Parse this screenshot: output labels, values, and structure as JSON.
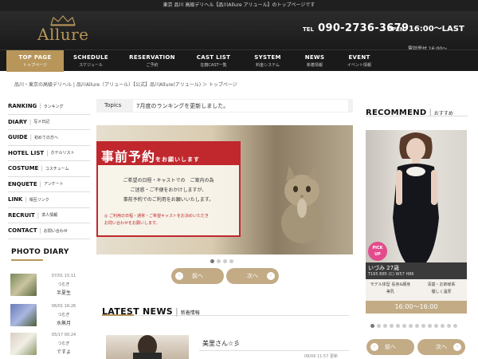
{
  "top_strip": {
    "text": "東京 品川 高級デリヘル【品川Allure アリュール】のトップページです"
  },
  "header": {
    "logo_text": "Allure",
    "tel_label": "TEL",
    "tel_number": "090-2736-3679",
    "open_label": "OPEN",
    "open_hours": "16:00～LAST",
    "reception": "電話受付 16:00～"
  },
  "nav": [
    {
      "en": "TOP PAGE",
      "jp": "トップページ",
      "active": true
    },
    {
      "en": "SCHEDULE",
      "jp": "スケジュール"
    },
    {
      "en": "RESERVATION",
      "jp": "ご予約"
    },
    {
      "en": "CAST LIST",
      "jp": "在籍CAST一覧"
    },
    {
      "en": "SYSTEM",
      "jp": "料金システム"
    },
    {
      "en": "NEWS",
      "jp": "新着情報"
    },
    {
      "en": "EVENT",
      "jp": "イベント情報"
    }
  ],
  "breadcrumb": "品川・東京の高級デリヘル | 品川Allure（アリュール）【公式】品川Allure(アリュール) ＞ トップページ",
  "sidebar": [
    {
      "en": "RANKING",
      "jp": "ランキング"
    },
    {
      "en": "DIARY",
      "jp": "写メ日記"
    },
    {
      "en": "GUIDE",
      "jp": "初めての方へ"
    },
    {
      "en": "HOTEL LIST",
      "jp": "ホテルリスト"
    },
    {
      "en": "COSTUME",
      "jp": "コスチューム"
    },
    {
      "en": "ENQUETE",
      "jp": "アンケート"
    },
    {
      "en": "LINK",
      "jp": "相互リンク"
    },
    {
      "en": "RECRUIT",
      "jp": "求人情報"
    },
    {
      "en": "CONTACT",
      "jp": "お問い合わせ"
    }
  ],
  "photo_diary": {
    "title": "PHOTO DIARY",
    "entries": [
      {
        "date": "07/01 15:11",
        "user": "つむぎ",
        "title": "半夏生"
      },
      {
        "date": "06/01 16:26",
        "user": "つむぎ",
        "title": "水無月"
      },
      {
        "date": "05/17 00:24",
        "user": "つむぎ",
        "title": "ですよ"
      }
    ]
  },
  "topics": {
    "label": "Topics",
    "text": "7月度のランキングを更新しました。"
  },
  "banner": {
    "head_big": "事前予約",
    "head_small": "をお願いします",
    "lines": [
      "ご希望の日程・キャストでの　ご案内の為",
      "ご迷惑・ご不便をおかけしますが、",
      "事前予約でのご利用をお願いいたします。"
    ],
    "notes": [
      "◎ ご利用の日程・通常・ご希望キャストをお決めいただき",
      "お問い合わせをお願いします。"
    ]
  },
  "slider": {
    "prev_label": "前へ",
    "next_label": "次へ"
  },
  "latest_news": {
    "title_en": "LATEST NEWS",
    "title_jp": "新着情報",
    "item_title": "美里さん☆彡",
    "item_date": "08/06 11:57 更新"
  },
  "recommend": {
    "title_en": "RECOMMEND",
    "title_jp": "おすすめ",
    "pickup_line1": "PICK",
    "pickup_line2": "UP",
    "name": "いづみ 27歳",
    "stats": "T165 B85 (C) W57 H86",
    "tags": [
      "モデル体型 長身&細身",
      "清楚・お姉様系",
      "美乳",
      "優しく温厚"
    ],
    "time": "16:00～16:00",
    "prev_label": "前へ",
    "next_label": "次へ"
  },
  "colors": {
    "accent_gold": "#b8965a",
    "pill_gold": "#c2ab85",
    "banner_red": "#c0282e",
    "pickup_pink": "#e44b8c"
  },
  "icons": [
    "crown-icon",
    "chevron-left-icon",
    "chevron-right-icon"
  ]
}
